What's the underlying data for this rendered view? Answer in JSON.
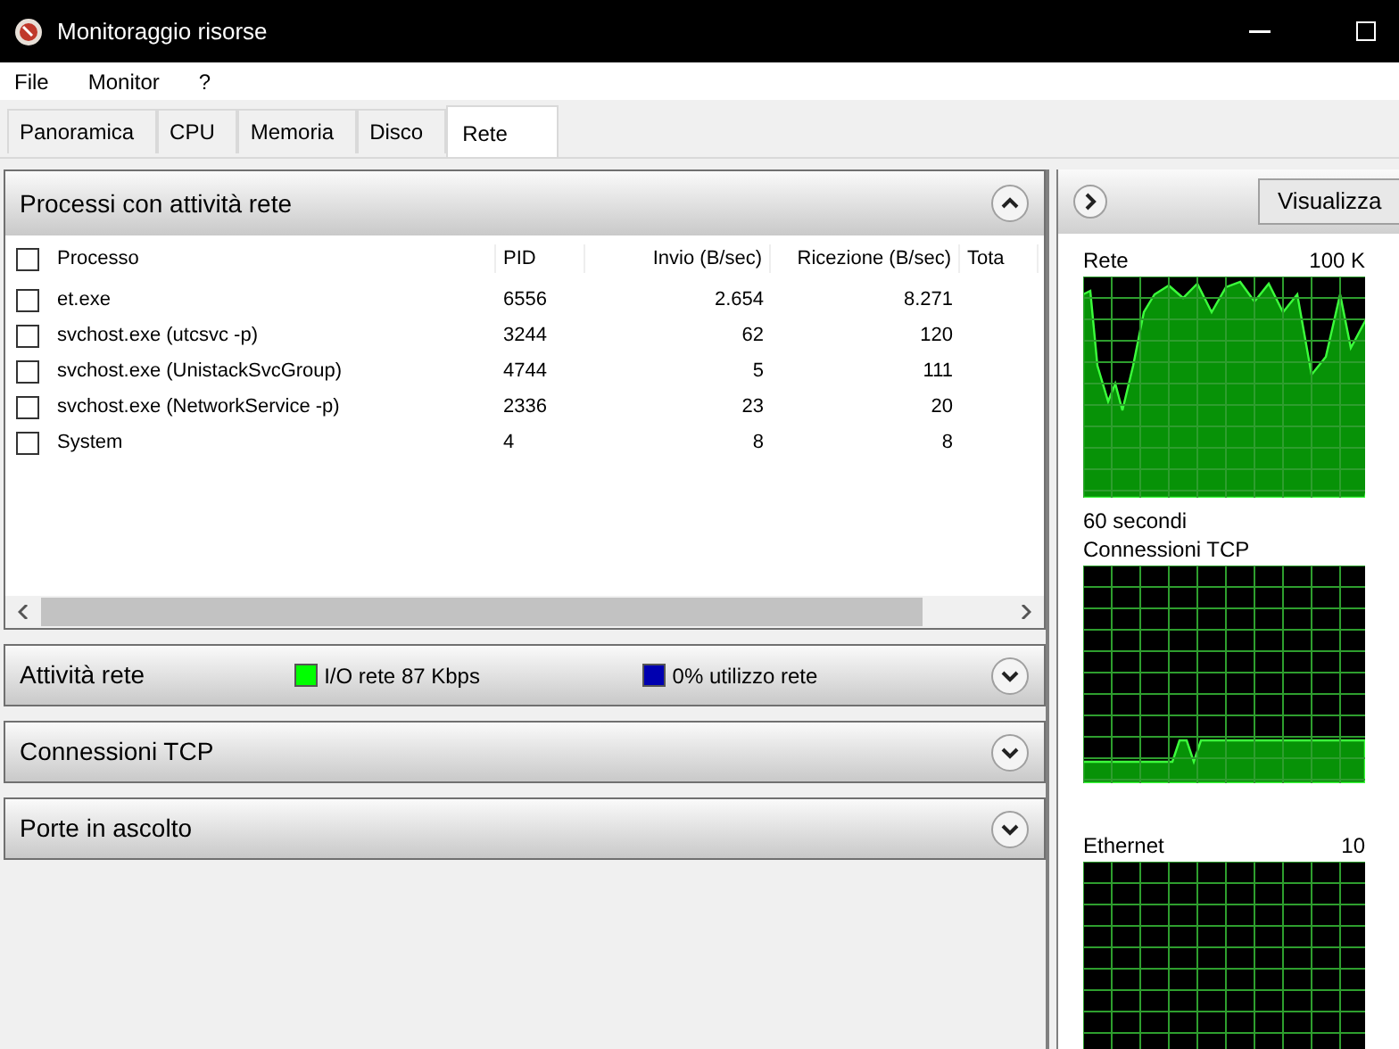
{
  "window": {
    "title": "Monitoraggio risorse"
  },
  "menu": [
    "File",
    "Monitor",
    "?"
  ],
  "tabs": [
    {
      "label": "Panoramica",
      "selected": false
    },
    {
      "label": "CPU",
      "selected": false
    },
    {
      "label": "Memoria",
      "selected": false
    },
    {
      "label": "Disco",
      "selected": false
    },
    {
      "label": "Rete",
      "selected": true
    }
  ],
  "processes": {
    "title": "Processi con attività rete",
    "expanded": true,
    "columns": [
      "Processo",
      "PID",
      "Invio (B/sec)",
      "Ricezione (B/sec)",
      "Tota"
    ],
    "header_checked": false,
    "rows": [
      {
        "checked": false,
        "cells": [
          "et.exe",
          "6556",
          "2.654",
          "8.271"
        ]
      },
      {
        "checked": false,
        "cells": [
          "svchost.exe (utcsvc -p)",
          "3244",
          "62",
          "120"
        ]
      },
      {
        "checked": false,
        "cells": [
          "svchost.exe (UnistackSvcGroup)",
          "4744",
          "5",
          "111"
        ]
      },
      {
        "checked": false,
        "cells": [
          "svchost.exe (NetworkService -p)",
          "2336",
          "23",
          "20"
        ]
      },
      {
        "checked": false,
        "cells": [
          "System",
          "4",
          "8",
          "8"
        ]
      }
    ]
  },
  "sections": [
    {
      "title": "Attività rete",
      "expanded": false,
      "legend": [
        {
          "label": "I/O rete 87 Kbps",
          "color": "#00ff00"
        },
        {
          "label": "0% utilizzo rete",
          "color": "#0000b0"
        }
      ]
    },
    {
      "title": "Connessioni TCP",
      "expanded": false
    },
    {
      "title": "Porte in ascolto",
      "expanded": false
    }
  ],
  "graphs_pane": {
    "view_button": "Visualizza",
    "graphs": [
      {
        "kind": "busy",
        "label": "Rete",
        "value": "100 K",
        "footer": "60 secondi"
      },
      {
        "kind": "low",
        "label": "Connessioni TCP"
      },
      {
        "kind": "idle",
        "label": "Ethernet",
        "value": "10"
      }
    ]
  }
}
